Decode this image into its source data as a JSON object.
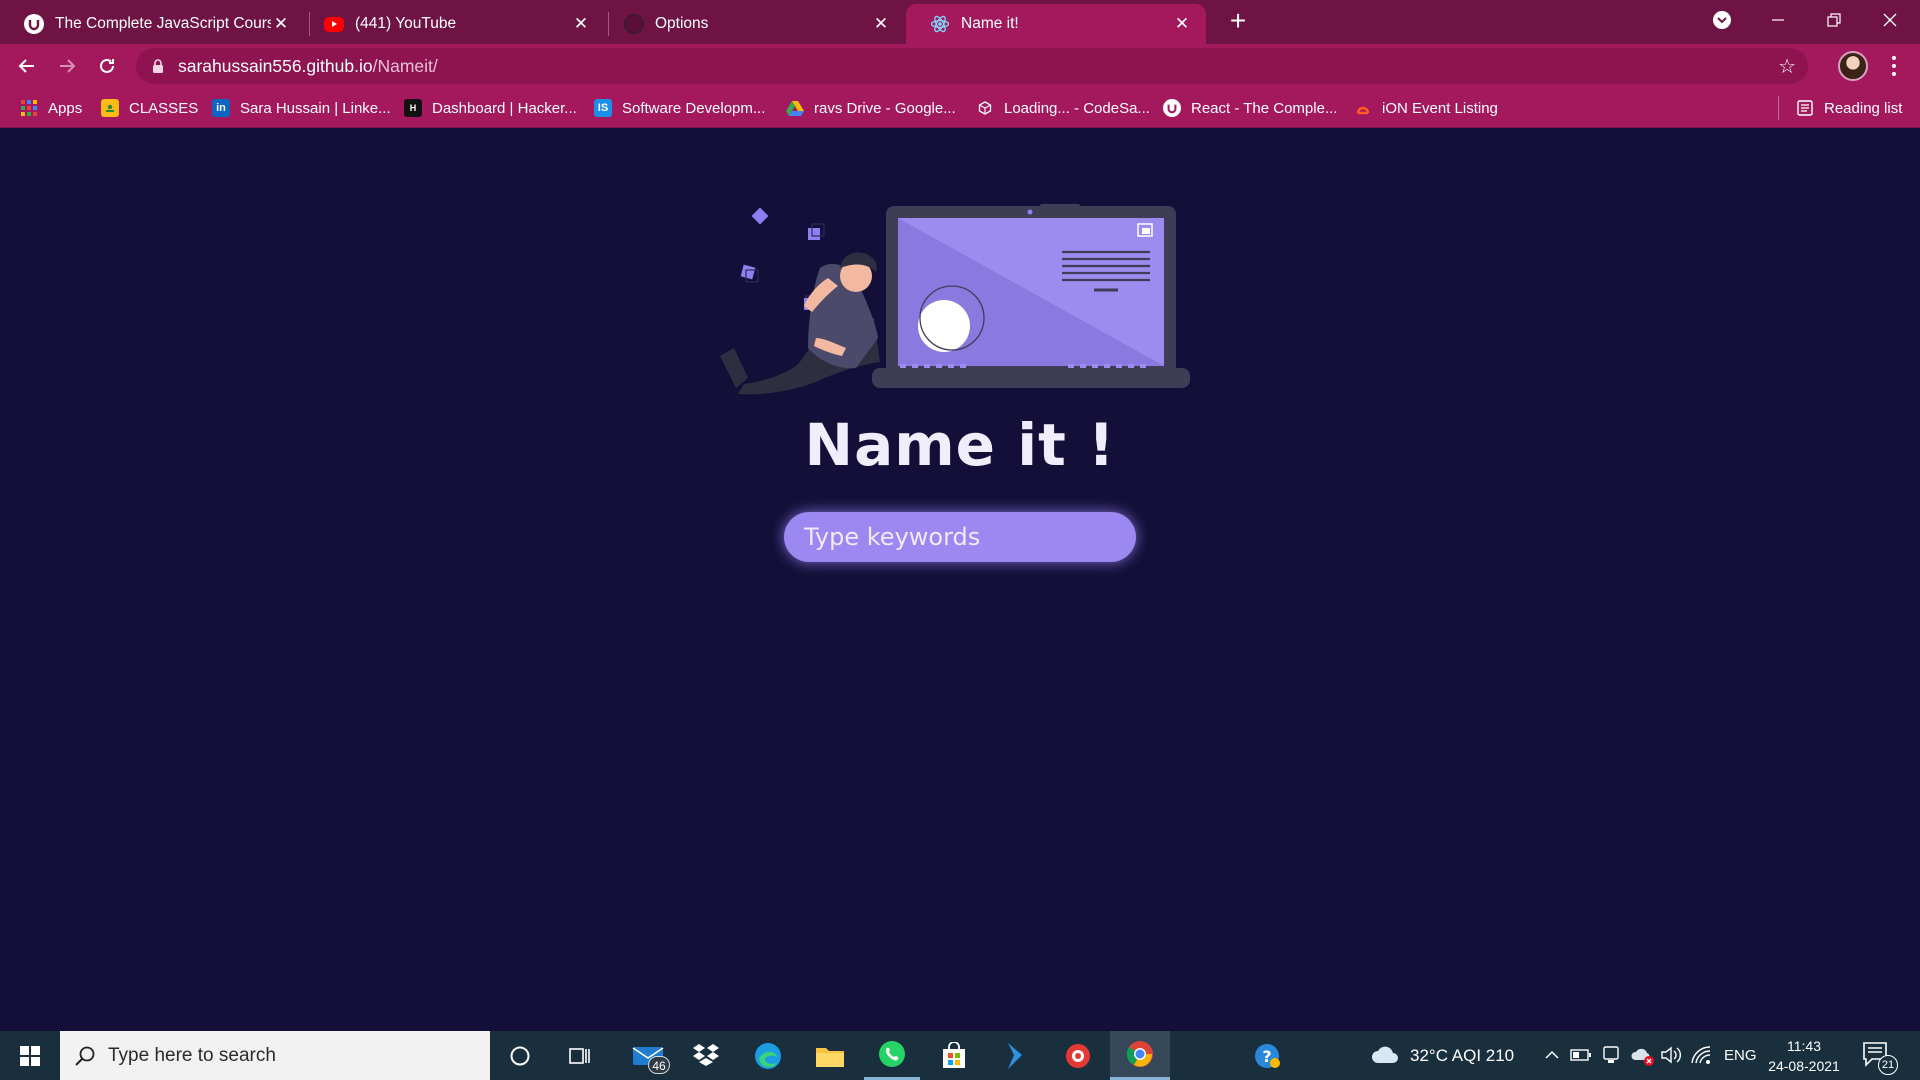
{
  "browser": {
    "tabs": [
      {
        "title": "The Complete JavaScript Course",
        "icon": "udemy-icon"
      },
      {
        "title": "(441) YouTube",
        "icon": "youtube-icon"
      },
      {
        "title": "Options",
        "icon": "github-icon"
      },
      {
        "title": "Name it!",
        "icon": "react-icon"
      }
    ],
    "active_tab": 3,
    "url_host": "sarahussain556.github.io",
    "url_path": "/Nameit/",
    "bookmarks": [
      {
        "label": "Apps",
        "icon": "apps-grid-icon"
      },
      {
        "label": "CLASSES",
        "icon": "classroom-icon"
      },
      {
        "label": "Sara Hussain | Linke...",
        "icon": "linkedin-icon"
      },
      {
        "label": "Dashboard | Hacker...",
        "icon": "hackerrank-icon"
      },
      {
        "label": "Software Developm...",
        "icon": "is-icon"
      },
      {
        "label": "ravs Drive - Google...",
        "icon": "drive-icon"
      },
      {
        "label": "Loading... - CodeSa...",
        "icon": "codesandbox-icon"
      },
      {
        "label": "React - The Comple...",
        "icon": "udemy-icon"
      },
      {
        "label": "iON Event Listing",
        "icon": "ion-icon"
      }
    ],
    "reading_list": "Reading list"
  },
  "page": {
    "title": "Name it !",
    "search_placeholder": "Type keywords",
    "accent_color": "#9b88f0",
    "background_color": "#130f38"
  },
  "taskbar": {
    "search_placeholder": "Type here to search",
    "mail_badge": "46",
    "weather": "32°C  AQI 210",
    "language": "ENG",
    "time": "11:43",
    "date": "24-08-2021",
    "notification_count": "21"
  }
}
